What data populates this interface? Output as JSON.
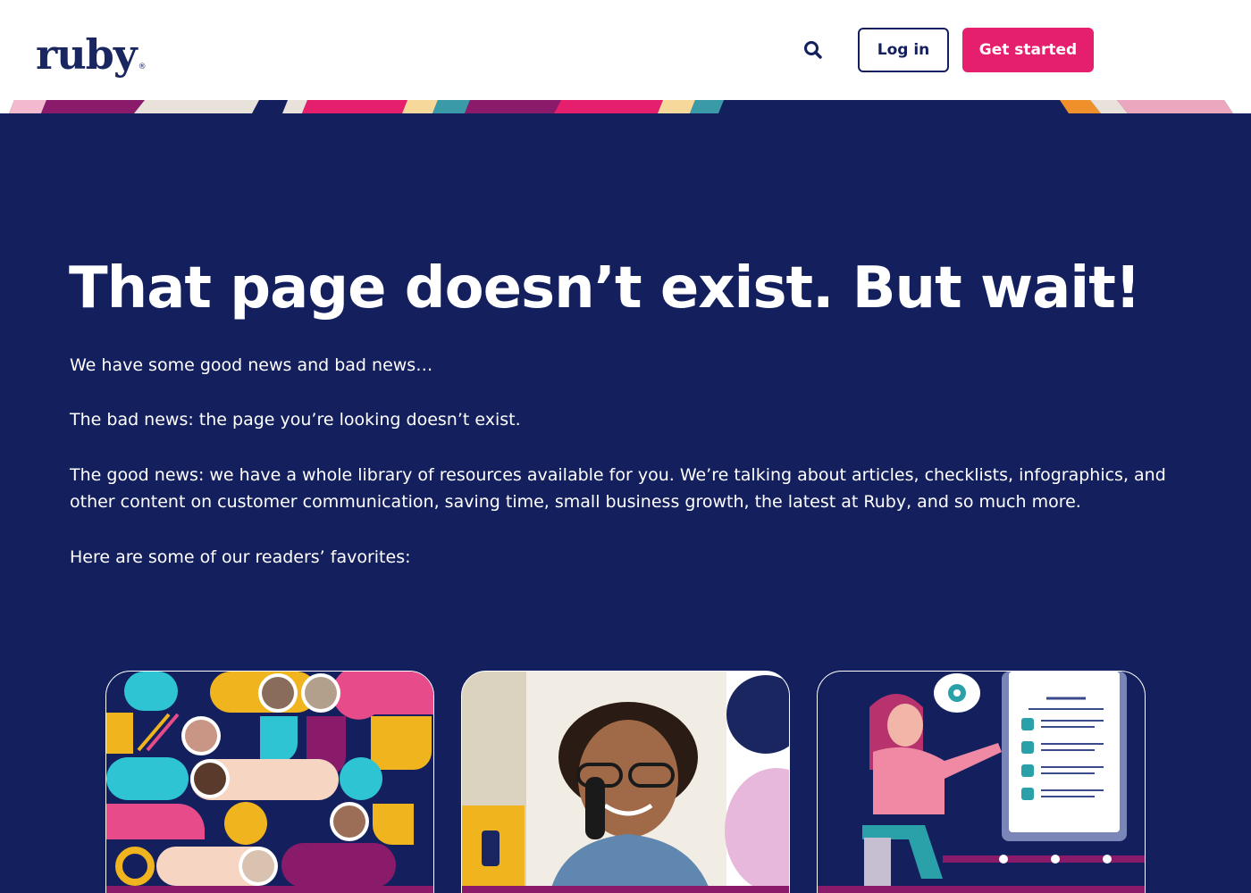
{
  "header": {
    "logo_text": "ruby",
    "logo_mark": "®",
    "search_icon": "search-icon",
    "login_label": "Log in",
    "get_started_label": "Get started"
  },
  "hero": {
    "title": "That page doesn’t exist. But wait!",
    "paragraphs": [
      "We have some good news and bad news…",
      "The bad news: the page you’re looking doesn’t exist.",
      "The good news: we have a whole library of resources available for you. We’re talking about articles, checklists, infographics, and other content on customer communication, saving time, small business growth, the latest at Ruby, and so much more.",
      "Here are some of our readers’ favorites:"
    ]
  },
  "colors": {
    "navy": "#14205e",
    "pink": "#e61e6e",
    "white": "#ffffff",
    "magenta": "#8a1a6a",
    "teal": "#2fc4d4",
    "yellow": "#f0b41e",
    "peach": "#f6d6c2"
  },
  "cards": [
    {
      "image": "people-collage-illustration"
    },
    {
      "image": "man-on-phone-photo"
    },
    {
      "image": "receptionist-checklist-illustration"
    }
  ]
}
